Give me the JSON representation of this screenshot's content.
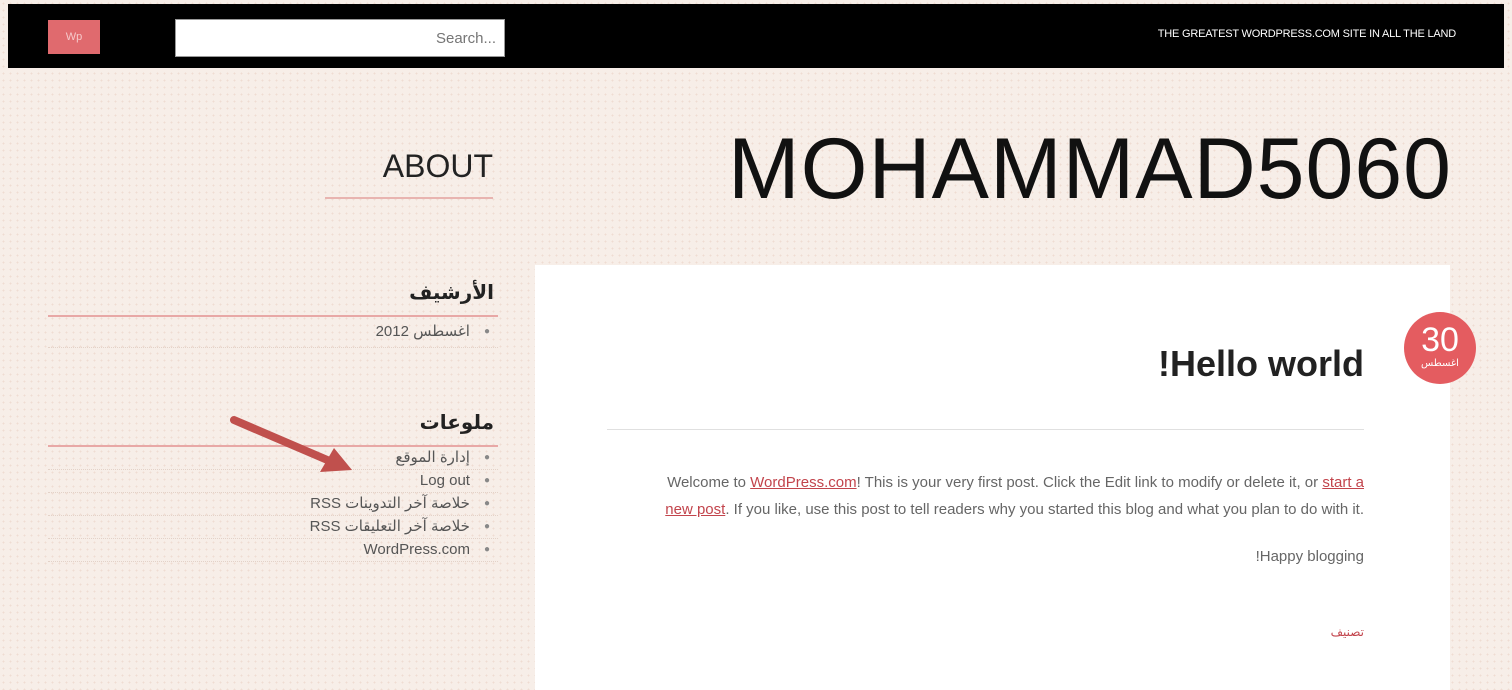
{
  "topbar": {
    "logo_text": "Wp",
    "search_placeholder": "Search...",
    "tagline": "THE GREATEST WORDPRESS.COM SITE IN ALL THE LAND"
  },
  "site_title": "MOHAMMAD5060",
  "about_label": "ABOUT",
  "sidebar": {
    "archive_title": "الأرشيف",
    "archive_items": [
      "اغسطس 2012"
    ],
    "meta_title": "ملوعات",
    "meta_items": [
      "إدارة الموقع",
      "Log out",
      "خلاصة آخر التدوينات RSS",
      "خلاصة آخر التعليقات RSS",
      "WordPress.com"
    ]
  },
  "post": {
    "title": "!Hello world",
    "date_day": "30",
    "date_month": "اغسطس",
    "body_intro": "Welcome to ",
    "body_link1": "WordPress.com",
    "body_mid": "! This is your very first post. Click the Edit link to modify or delete it, or ",
    "body_link2": "start a new post",
    "body_end": ". If you like, use this post to tell readers why you started this blog and what you plan to do with it.",
    "body_p2": "!Happy blogging",
    "category": "تصنيف"
  },
  "colors": {
    "accent": "#e45c60",
    "background": "#f7eee8",
    "topbar": "#000000",
    "arrow": "#c0504d"
  }
}
